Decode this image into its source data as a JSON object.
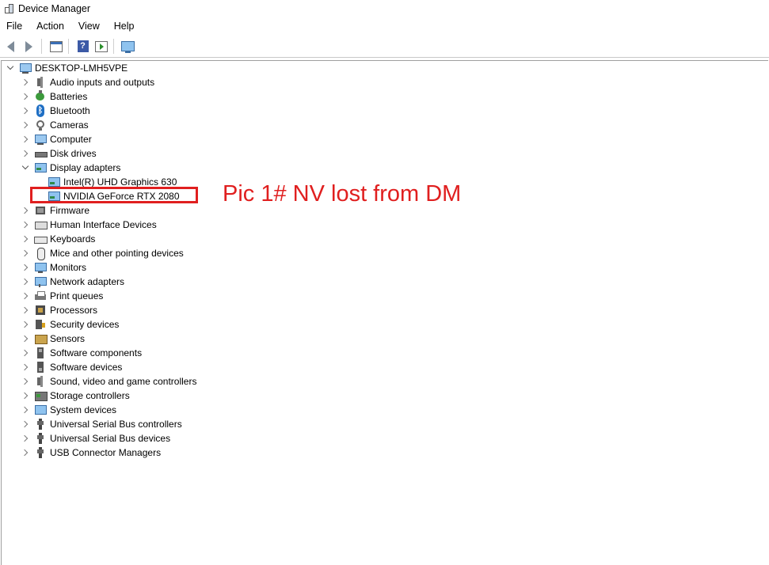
{
  "window": {
    "title": "Device Manager"
  },
  "menu": [
    "File",
    "Action",
    "View",
    "Help"
  ],
  "toolbar": {
    "buttons": [
      "back-arrow-icon",
      "forward-arrow-icon",
      "properties-icon",
      "help-icon",
      "update-driver-icon",
      "scan-monitor-icon"
    ]
  },
  "tree": {
    "root": "DESKTOP-LMH5VPE",
    "categories": [
      {
        "label": "Audio inputs and outputs",
        "icon": "speaker-icon",
        "expanded": false
      },
      {
        "label": "Batteries",
        "icon": "battery-icon",
        "expanded": false
      },
      {
        "label": "Bluetooth",
        "icon": "bluetooth-icon",
        "expanded": false
      },
      {
        "label": "Cameras",
        "icon": "camera-icon",
        "expanded": false
      },
      {
        "label": "Computer",
        "icon": "computer-icon",
        "expanded": false
      },
      {
        "label": "Disk drives",
        "icon": "disk-drive-icon",
        "expanded": false
      },
      {
        "label": "Display adapters",
        "icon": "display-adapter-icon",
        "expanded": true,
        "children": [
          "Intel(R) UHD Graphics 630",
          "NVIDIA GeForce RTX 2080"
        ]
      },
      {
        "label": "Firmware",
        "icon": "firmware-icon",
        "expanded": false
      },
      {
        "label": "Human Interface Devices",
        "icon": "hid-icon",
        "expanded": false
      },
      {
        "label": "Keyboards",
        "icon": "keyboard-icon",
        "expanded": false
      },
      {
        "label": "Mice and other pointing devices",
        "icon": "mouse-icon",
        "expanded": false
      },
      {
        "label": "Monitors",
        "icon": "monitor-icon",
        "expanded": false
      },
      {
        "label": "Network adapters",
        "icon": "network-adapter-icon",
        "expanded": false
      },
      {
        "label": "Print queues",
        "icon": "printer-icon",
        "expanded": false
      },
      {
        "label": "Processors",
        "icon": "processor-icon",
        "expanded": false
      },
      {
        "label": "Security devices",
        "icon": "security-device-icon",
        "expanded": false
      },
      {
        "label": "Sensors",
        "icon": "sensor-icon",
        "expanded": false
      },
      {
        "label": "Software components",
        "icon": "software-component-icon",
        "expanded": false
      },
      {
        "label": "Software devices",
        "icon": "software-device-icon",
        "expanded": false
      },
      {
        "label": "Sound, video and game controllers",
        "icon": "sound-controller-icon",
        "expanded": false
      },
      {
        "label": "Storage controllers",
        "icon": "storage-controller-icon",
        "expanded": false
      },
      {
        "label": "System devices",
        "icon": "system-device-icon",
        "expanded": false
      },
      {
        "label": "Universal Serial Bus controllers",
        "icon": "usb-controller-icon",
        "expanded": false
      },
      {
        "label": "Universal Serial Bus devices",
        "icon": "usb-device-icon",
        "expanded": false
      },
      {
        "label": "USB Connector Managers",
        "icon": "usb-connector-icon",
        "expanded": false
      }
    ]
  },
  "annotation": {
    "text": "Pic 1# NV lost from DM",
    "color": "#e01f1f"
  }
}
